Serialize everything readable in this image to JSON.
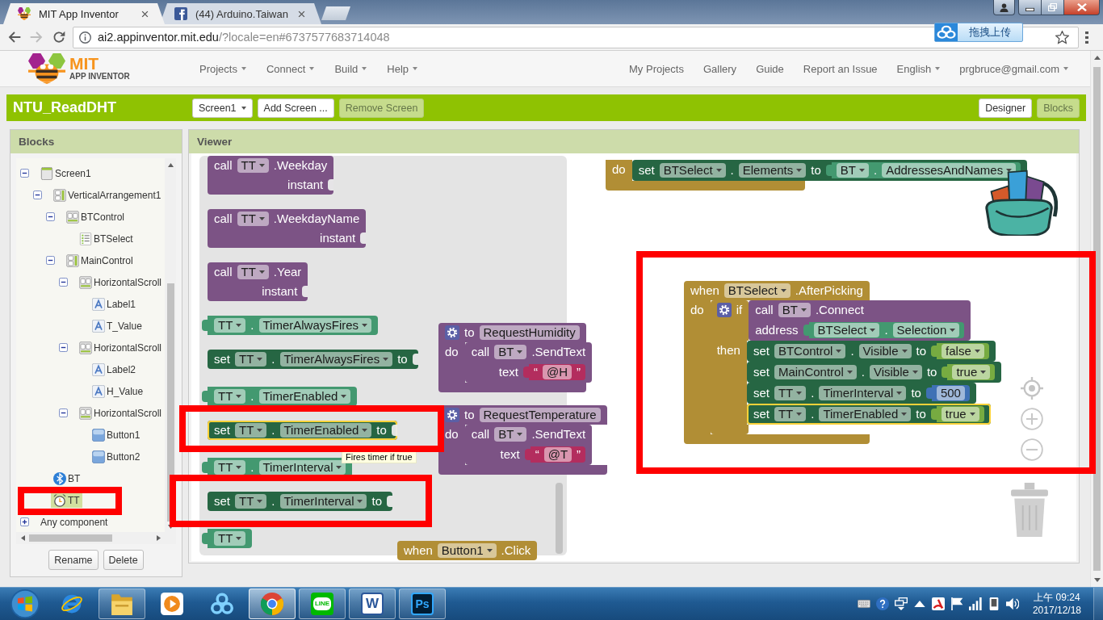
{
  "browser": {
    "tabs": [
      {
        "title": "MIT App Inventor",
        "kind": "appinventor",
        "selected": true
      },
      {
        "title": "(44) Arduino.Taiwan",
        "kind": "facebook",
        "selected": false
      }
    ],
    "address": {
      "host": "ai2.appinventor.mit.edu",
      "path": "/?locale=en#6737577683714048"
    },
    "extension_button": "拖拽上传"
  },
  "nav": {
    "logo": {
      "title": "MIT",
      "subtitle": "APP INVENTOR"
    },
    "menus": [
      "Projects",
      "Connect",
      "Build",
      "Help"
    ],
    "links": [
      "My Projects",
      "Gallery",
      "Guide",
      "Report an Issue"
    ],
    "dropdowns": [
      "English",
      "prgbruce@gmail.com"
    ]
  },
  "project_bar": {
    "name": "NTU_ReadDHT",
    "buttons": [
      {
        "label": "Screen1",
        "kind": "dropdown",
        "disabled": false
      },
      {
        "label": "Add Screen ...",
        "kind": "plain",
        "disabled": false
      },
      {
        "label": "Remove Screen",
        "kind": "plain",
        "disabled": true
      }
    ],
    "views": [
      {
        "label": "Designer",
        "selected": false
      },
      {
        "label": "Blocks",
        "selected": true
      }
    ]
  },
  "blocks_panel": {
    "title": "Blocks",
    "tree": [
      {
        "label": "Screen1",
        "kind": "screen",
        "expanded": true,
        "selected": false,
        "children": [
          {
            "label": "VerticalArrangement1",
            "kind": "vertical",
            "expanded": true,
            "selected": false,
            "children": [
              {
                "label": "BTControl",
                "kind": "horizontal",
                "expanded": true,
                "selected": false,
                "children": [
                  {
                    "label": "BTSelect",
                    "kind": "listpicker",
                    "selected": false
                  }
                ]
              },
              {
                "label": "MainControl",
                "kind": "vertical",
                "expanded": true,
                "selected": false,
                "children": [
                  {
                    "label": "HorizontalScroll",
                    "kind": "horizontal",
                    "expanded": true,
                    "selected": false,
                    "children": [
                      {
                        "label": "Label1",
                        "kind": "label",
                        "selected": false
                      },
                      {
                        "label": "T_Value",
                        "kind": "label",
                        "selected": false
                      }
                    ]
                  },
                  {
                    "label": "HorizontalScroll",
                    "kind": "horizontal",
                    "expanded": true,
                    "selected": false,
                    "children": [
                      {
                        "label": "Label2",
                        "kind": "label",
                        "selected": false
                      },
                      {
                        "label": "H_Value",
                        "kind": "label",
                        "selected": false
                      }
                    ]
                  },
                  {
                    "label": "HorizontalScroll",
                    "kind": "horizontal",
                    "expanded": true,
                    "selected": false,
                    "children": [
                      {
                        "label": "Button1",
                        "kind": "button",
                        "selected": false
                      },
                      {
                        "label": "Button2",
                        "kind": "button",
                        "selected": false
                      }
                    ]
                  }
                ]
              }
            ]
          },
          {
            "label": "BT",
            "kind": "bluetooth",
            "selected": false
          },
          {
            "label": "TT",
            "kind": "clock",
            "selected": true
          }
        ]
      },
      {
        "label": "Any component",
        "kind": "any",
        "expanded": false,
        "selected": false
      }
    ],
    "buttons": [
      "Rename",
      "Delete"
    ]
  },
  "viewer": {
    "title": "Viewer",
    "workspace_blocks": [
      {
        "kind": "event",
        "selected": false,
        "rows": [
          {
            "items": [
              {
                "kind": "label",
                "text": "do"
              }
            ],
            "statements": [
              {
                "kind": "setter",
                "selected": false,
                "rows": [
                  {
                    "items": [
                      {
                        "kind": "label",
                        "text": "set"
                      },
                      {
                        "kind": "dropdown",
                        "text": "BTSelect"
                      },
                      {
                        "kind": "label",
                        "text": "."
                      },
                      {
                        "kind": "dropdown",
                        "text": "Elements"
                      },
                      {
                        "kind": "label",
                        "text": "to"
                      },
                      {
                        "kind": "block",
                        "block": {
                          "kind": "getter",
                          "rows": [
                            {
                              "items": [
                                {
                                  "kind": "dropdown",
                                  "text": "BT"
                                },
                                {
                                  "kind": "label",
                                  "text": "."
                                },
                                {
                                  "kind": "dropdown",
                                  "text": "AddressesAndNames"
                                }
                              ]
                            }
                          ]
                        }
                      }
                    ]
                  }
                ]
              }
            ]
          }
        ]
      },
      {
        "kind": "procedure",
        "selected": false,
        "rows": [
          {
            "items": [
              {
                "kind": "label",
                "text": "to"
              },
              {
                "kind": "input",
                "text": "RequestHumidity"
              }
            ]
          },
          {
            "items": [
              {
                "kind": "label",
                "text": "do"
              }
            ],
            "statements": [
              {
                "kind": "call_statement",
                "selected": false,
                "rows": [
                  {
                    "items": [
                      {
                        "kind": "label",
                        "text": "call"
                      },
                      {
                        "kind": "dropdown",
                        "text": "BT"
                      },
                      {
                        "kind": "label",
                        "text": ".SendText"
                      }
                    ]
                  },
                  {
                    "items": [
                      {
                        "kind": "label",
                        "text": "text"
                      },
                      {
                        "kind": "block",
                        "block": {
                          "kind": "text",
                          "rows": [
                            {
                              "items": [
                                {
                                  "kind": "label",
                                  "text": "“"
                                },
                                {
                                  "kind": "input",
                                  "text": "@H"
                                },
                                {
                                  "kind": "label",
                                  "text": "”"
                                }
                              ]
                            }
                          ]
                        }
                      }
                    ]
                  }
                ]
              }
            ]
          }
        ]
      },
      {
        "kind": "procedure",
        "selected": false,
        "rows": [
          {
            "items": [
              {
                "kind": "label",
                "text": "to"
              },
              {
                "kind": "input",
                "text": "RequestTemperature"
              }
            ]
          },
          {
            "items": [
              {
                "kind": "label",
                "text": "do"
              }
            ],
            "statements": [
              {
                "kind": "call_statement",
                "selected": false,
                "rows": [
                  {
                    "items": [
                      {
                        "kind": "label",
                        "text": "call"
                      },
                      {
                        "kind": "dropdown",
                        "text": "BT"
                      },
                      {
                        "kind": "label",
                        "text": ".SendText"
                      }
                    ]
                  },
                  {
                    "items": [
                      {
                        "kind": "label",
                        "text": "text"
                      },
                      {
                        "kind": "block",
                        "block": {
                          "kind": "text",
                          "rows": [
                            {
                              "items": [
                                {
                                  "kind": "label",
                                  "text": "“"
                                },
                                {
                                  "kind": "input",
                                  "text": "@T"
                                },
                                {
                                  "kind": "label",
                                  "text": "”"
                                }
                              ]
                            }
                          ]
                        }
                      }
                    ]
                  }
                ]
              }
            ]
          }
        ]
      },
      {
        "kind": "event",
        "selected": false,
        "rows": [
          {
            "items": [
              {
                "kind": "label",
                "text": "when"
              },
              {
                "kind": "dropdown",
                "text": "BTSelect"
              },
              {
                "kind": "label",
                "text": ".AfterPicking"
              }
            ]
          },
          {
            "items": [
              {
                "kind": "label",
                "text": "do"
              }
            ],
            "statements": [
              {
                "kind": "control",
                "selected": false,
                "rows": [
                  {
                    "items": [
                      {
                        "kind": "label",
                        "text": "if"
                      },
                      {
                        "kind": "block",
                        "block": {
                          "kind": "call_value",
                          "rows": [
                            {
                              "items": [
                                {
                                  "kind": "label",
                                  "text": "call"
                                },
                                {
                                  "kind": "dropdown",
                                  "text": "BT"
                                },
                                {
                                  "kind": "label",
                                  "text": ".Connect"
                                }
                              ]
                            },
                            {
                              "items": [
                                {
                                  "kind": "label",
                                  "text": "address"
                                },
                                {
                                  "kind": "block",
                                  "block": {
                                    "kind": "getter",
                                    "rows": [
                                      {
                                        "items": [
                                          {
                                            "kind": "dropdown",
                                            "text": "BTSelect"
                                          },
                                          {
                                            "kind": "label",
                                            "text": "."
                                          },
                                          {
                                            "kind": "dropdown",
                                            "text": "Selection"
                                          }
                                        ]
                                      }
                                    ]
                                  }
                                }
                              ]
                            }
                          ]
                        }
                      }
                    ]
                  },
                  {
                    "items": [
                      {
                        "kind": "label",
                        "text": "then"
                      }
                    ],
                    "statements": [
                      {
                        "kind": "setter",
                        "selected": false,
                        "rows": [
                          {
                            "items": [
                              {
                                "kind": "label",
                                "text": "set"
                              },
                              {
                                "kind": "dropdown",
                                "text": "BTControl"
                              },
                              {
                                "kind": "label",
                                "text": "."
                              },
                              {
                                "kind": "dropdown",
                                "text": "Visible"
                              },
                              {
                                "kind": "label",
                                "text": "to"
                              },
                              {
                                "kind": "block",
                                "block": {
                                  "kind": "logic",
                                  "rows": [
                                    {
                                      "items": [
                                        {
                                          "kind": "dropdown",
                                          "text": "false"
                                        }
                                      ]
                                    }
                                  ]
                                }
                              }
                            ]
                          }
                        ]
                      },
                      {
                        "kind": "setter",
                        "selected": false,
                        "rows": [
                          {
                            "items": [
                              {
                                "kind": "label",
                                "text": "set"
                              },
                              {
                                "kind": "dropdown",
                                "text": "MainControl"
                              },
                              {
                                "kind": "label",
                                "text": "."
                              },
                              {
                                "kind": "dropdown",
                                "text": "Visible"
                              },
                              {
                                "kind": "label",
                                "text": "to"
                              },
                              {
                                "kind": "block",
                                "block": {
                                  "kind": "logic",
                                  "rows": [
                                    {
                                      "items": [
                                        {
                                          "kind": "dropdown",
                                          "text": "true"
                                        }
                                      ]
                                    }
                                  ]
                                }
                              }
                            ]
                          }
                        ]
                      },
                      {
                        "kind": "setter",
                        "selected": false,
                        "rows": [
                          {
                            "items": [
                              {
                                "kind": "label",
                                "text": "set"
                              },
                              {
                                "kind": "dropdown",
                                "text": "TT"
                              },
                              {
                                "kind": "label",
                                "text": "."
                              },
                              {
                                "kind": "dropdown",
                                "text": "TimerInterval"
                              },
                              {
                                "kind": "label",
                                "text": "to"
                              },
                              {
                                "kind": "block",
                                "block": {
                                  "kind": "number",
                                  "rows": [
                                    {
                                      "items": [
                                        {
                                          "kind": "input",
                                          "text": "500"
                                        }
                                      ]
                                    }
                                  ]
                                }
                              }
                            ]
                          }
                        ]
                      },
                      {
                        "kind": "setter",
                        "selected": true,
                        "rows": [
                          {
                            "items": [
                              {
                                "kind": "label",
                                "text": "set"
                              },
                              {
                                "kind": "dropdown",
                                "text": "TT"
                              },
                              {
                                "kind": "label",
                                "text": "."
                              },
                              {
                                "kind": "dropdown",
                                "text": "TimerEnabled"
                              },
                              {
                                "kind": "label",
                                "text": "to"
                              },
                              {
                                "kind": "block",
                                "block": {
                                  "kind": "logic",
                                  "rows": [
                                    {
                                      "items": [
                                        {
                                          "kind": "dropdown",
                                          "text": "true"
                                        }
                                      ]
                                    }
                                  ]
                                }
                              }
                            ]
                          }
                        ]
                      }
                    ]
                  }
                ]
              }
            ]
          }
        ]
      },
      {
        "kind": "event",
        "selected": false,
        "rows": [
          {
            "items": [
              {
                "kind": "label",
                "text": "when"
              },
              {
                "kind": "dropdown",
                "text": "Button1"
              },
              {
                "kind": "label",
                "text": ".Click"
              }
            ]
          }
        ]
      }
    ],
    "flyout": {
      "blocks": [
        {
          "kind": "call_value",
          "selected": false,
          "rows": [
            {
              "items": [
                {
                  "kind": "label",
                  "text": "call"
                },
                {
                  "kind": "dropdown",
                  "text": "TT"
                },
                {
                  "kind": "label",
                  "text": ".Weekday"
                }
              ]
            },
            {
              "items": [
                {
                  "kind": "label",
                  "text": "instant"
                },
                {
                  "kind": "socket"
                }
              ]
            }
          ]
        },
        {
          "kind": "call_value",
          "selected": false,
          "rows": [
            {
              "items": [
                {
                  "kind": "label",
                  "text": "call"
                },
                {
                  "kind": "dropdown",
                  "text": "TT"
                },
                {
                  "kind": "label",
                  "text": ".WeekdayName"
                }
              ]
            },
            {
              "items": [
                {
                  "kind": "label",
                  "text": "instant"
                },
                {
                  "kind": "socket"
                }
              ]
            }
          ]
        },
        {
          "kind": "call_value",
          "selected": false,
          "rows": [
            {
              "items": [
                {
                  "kind": "label",
                  "text": "call"
                },
                {
                  "kind": "dropdown",
                  "text": "TT"
                },
                {
                  "kind": "label",
                  "text": ".Year"
                }
              ]
            },
            {
              "items": [
                {
                  "kind": "label",
                  "text": "instant"
                },
                {
                  "kind": "socket"
                }
              ]
            }
          ]
        },
        {
          "kind": "getter",
          "selected": false,
          "rows": [
            {
              "items": [
                {
                  "kind": "dropdown",
                  "text": "TT"
                },
                {
                  "kind": "label",
                  "text": "."
                },
                {
                  "kind": "dropdown",
                  "text": "TimerAlwaysFires"
                }
              ]
            }
          ]
        },
        {
          "kind": "setter",
          "selected": false,
          "rows": [
            {
              "items": [
                {
                  "kind": "label",
                  "text": "set"
                },
                {
                  "kind": "dropdown",
                  "text": "TT"
                },
                {
                  "kind": "label",
                  "text": "."
                },
                {
                  "kind": "dropdown",
                  "text": "TimerAlwaysFires"
                },
                {
                  "kind": "label",
                  "text": "to"
                },
                {
                  "kind": "socket"
                }
              ]
            }
          ]
        },
        {
          "kind": "getter",
          "selected": false,
          "rows": [
            {
              "items": [
                {
                  "kind": "dropdown",
                  "text": "TT"
                },
                {
                  "kind": "label",
                  "text": "."
                },
                {
                  "kind": "dropdown",
                  "text": "TimerEnabled"
                }
              ]
            }
          ]
        },
        {
          "kind": "setter",
          "selected": true,
          "rows": [
            {
              "items": [
                {
                  "kind": "label",
                  "text": "set"
                },
                {
                  "kind": "dropdown",
                  "text": "TT"
                },
                {
                  "kind": "label",
                  "text": "."
                },
                {
                  "kind": "dropdown",
                  "text": "TimerEnabled"
                },
                {
                  "kind": "label",
                  "text": "to"
                },
                {
                  "kind": "socket"
                }
              ]
            }
          ]
        },
        {
          "kind": "getter",
          "selected": false,
          "rows": [
            {
              "items": [
                {
                  "kind": "dropdown",
                  "text": "TT"
                },
                {
                  "kind": "label",
                  "text": "."
                },
                {
                  "kind": "dropdown",
                  "text": "TimerInterval"
                }
              ]
            }
          ]
        },
        {
          "kind": "setter",
          "selected": false,
          "rows": [
            {
              "items": [
                {
                  "kind": "label",
                  "text": "set"
                },
                {
                  "kind": "dropdown",
                  "text": "TT"
                },
                {
                  "kind": "label",
                  "text": "."
                },
                {
                  "kind": "dropdown",
                  "text": "TimerInterval"
                },
                {
                  "kind": "label",
                  "text": "to"
                },
                {
                  "kind": "socket"
                }
              ]
            }
          ]
        },
        {
          "kind": "component",
          "selected": false,
          "rows": [
            {
              "items": [
                {
                  "kind": "dropdown",
                  "text": "TT"
                }
              ]
            }
          ]
        }
      ],
      "tooltip": "Fires timer if true"
    }
  },
  "taskbar": {
    "apps": [
      {
        "kind": "ie",
        "running": false,
        "selected": false
      },
      {
        "kind": "explorer",
        "running": true,
        "selected": false
      },
      {
        "kind": "media",
        "running": false,
        "selected": false
      },
      {
        "kind": "cloud",
        "running": false,
        "selected": false
      },
      {
        "kind": "chrome",
        "running": true,
        "selected": true
      },
      {
        "kind": "line",
        "label": "LINE",
        "running": true,
        "selected": false
      },
      {
        "kind": "word",
        "label": "W",
        "running": true,
        "selected": false
      },
      {
        "kind": "photoshop",
        "label": "Ps",
        "running": true,
        "selected": false
      }
    ],
    "clock": {
      "time": "上午 09:24",
      "date": "2017/12/18"
    }
  }
}
